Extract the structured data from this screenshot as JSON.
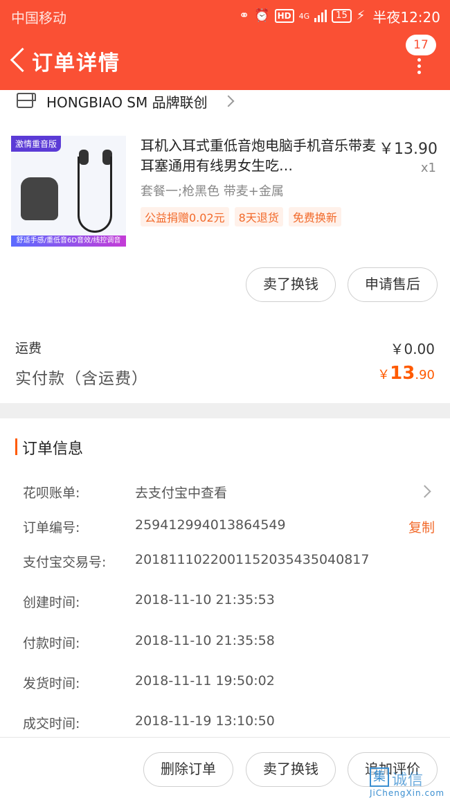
{
  "status_bar": {
    "carrier": "中国移动",
    "net": "4G",
    "battery": "15",
    "time": "半夜12:20"
  },
  "header": {
    "title": "订单详情",
    "badge_count": "17"
  },
  "shop": {
    "name": "HONGBIAO SM 品牌联创"
  },
  "product": {
    "thumb_tag": "激情重音版",
    "thumb_caption": "舒适手感/重低音6D音效/线控调音",
    "title": "耳机入耳式重低音炮电脑手机音乐带麦耳塞通用有线男女生吃…",
    "price": "￥13.90",
    "quantity": "x1",
    "sku": "套餐一;枪黑色 带麦+金属",
    "tags": [
      "公益捐赠0.02元",
      "8天退货",
      "免费换新"
    ]
  },
  "actions": {
    "sell_label": "卖了换钱",
    "after_sale_label": "申请售后"
  },
  "fees": {
    "shipping_label": "运费",
    "shipping_value": "￥0.00",
    "paid_label": "实付款（含运费）",
    "paid_currency": "￥",
    "paid_int": "13",
    "paid_dec": ".90"
  },
  "order_info": {
    "section_title": "订单信息",
    "huabei_label": "花呗账单:",
    "huabei_value": "去支付宝中查看",
    "order_no_label": "订单编号:",
    "order_no_value": "259412994013864549",
    "copy_label": "复制",
    "alipay_label": "支付宝交易号:",
    "alipay_value": "2018111022001152035435040817",
    "created_label": "创建时间:",
    "created_value": "2018-11-10 21:35:53",
    "paid_time_label": "付款时间:",
    "paid_time_value": "2018-11-10 21:35:58",
    "shipped_label": "发货时间:",
    "shipped_value": "2018-11-11 19:50:02",
    "completed_label": "成交时间:",
    "completed_value": "2018-11-19 13:10:50"
  },
  "bottom_bar": {
    "delete_label": "删除订单",
    "sell_label": "卖了换钱",
    "review_label": "追加评价"
  },
  "watermark": {
    "char": "集",
    "text": "诚信",
    "url": "JiChengXin.com"
  },
  "colors": {
    "header_bg": "#fa5034",
    "accent_orange": "#ff5a00",
    "tag_text": "#f26a2b"
  }
}
